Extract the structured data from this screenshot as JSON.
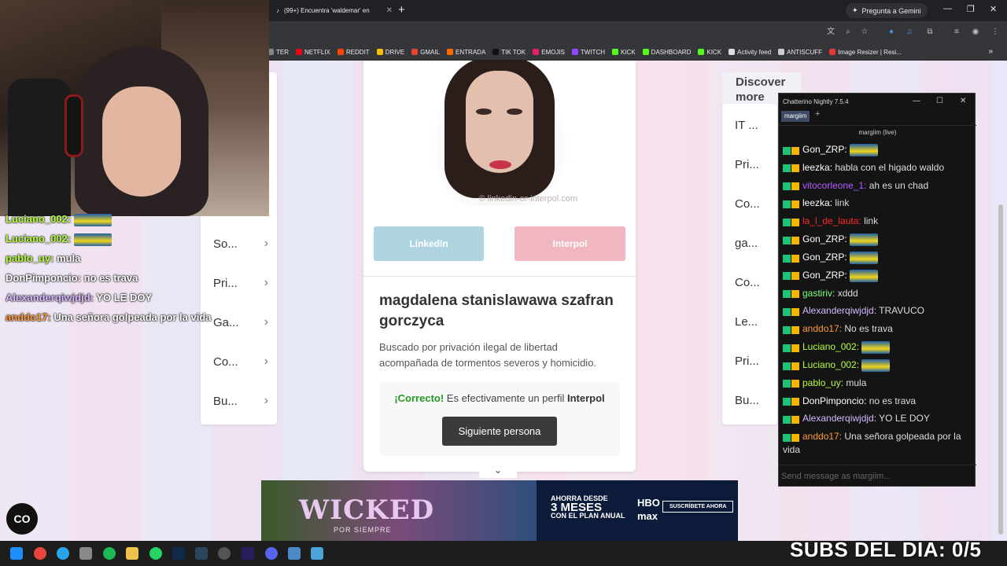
{
  "browser": {
    "tab_title": "(99+) Encuentra 'waldemar' en",
    "gemini_label": "Pregunta a Gemini",
    "bookmarks": [
      {
        "label": "TER",
        "color": "#888888"
      },
      {
        "label": "NETFLIX",
        "color": "#e50914"
      },
      {
        "label": "REDDIT",
        "color": "#ff4500"
      },
      {
        "label": "DRIVE",
        "color": "#fbbc04"
      },
      {
        "label": "GMAIL",
        "color": "#ea4335"
      },
      {
        "label": "ENTRADA",
        "color": "#ff6a00"
      },
      {
        "label": "TIK TOK",
        "color": "#111111"
      },
      {
        "label": "EMOJIS",
        "color": "#e91e63"
      },
      {
        "label": "TWITCH",
        "color": "#9146ff"
      },
      {
        "label": "KICK",
        "color": "#53fc18"
      },
      {
        "label": "DASHBOARD",
        "color": "#53fc18"
      },
      {
        "label": "KICK",
        "color": "#53fc18"
      },
      {
        "label": "Activity feed",
        "color": "#dddddd"
      },
      {
        "label": "ANTISCUFF",
        "color": "#cccccc"
      },
      {
        "label": "Image Resizer | Resi...",
        "color": "#e53935"
      }
    ]
  },
  "game": {
    "left_nav": [
      "So...",
      "Pri...",
      "Ga...",
      "Co...",
      "Bu..."
    ],
    "right_nav": [
      "IT ...",
      "Pri...",
      "Co...",
      "ga...",
      "Co...",
      "Le...",
      "Pri...",
      "Bu..."
    ],
    "discover_label": "Discover more",
    "photo_watermark": "© linkedin-or-interpol.com",
    "linkedin_label": "LinkedIn",
    "interpol_label": "Interpol",
    "person_name": "magdalena stanislawawa szafran gorczyca",
    "description": "Buscado por privación ilegal de libertad acompañada de tormentos severos y homicidio.",
    "result_ok": "¡Correcto!",
    "result_text": " Es efectivamente un perfil ",
    "result_type": "Interpol",
    "next_label": "Siguiente persona"
  },
  "ad": {
    "title": "WICKED",
    "subtitle": "POR SIEMPRE",
    "promo_line1": "AHORRA DESDE",
    "promo_line2": "3 MESES",
    "promo_line3": "CON EL PLAN ANUAL",
    "brand": "HBO max",
    "cta": "SUSCRÍBETE AHORA"
  },
  "chatterino": {
    "window_title": "Chatterino Nightly 7.5.4",
    "tab_label": "margiim",
    "channel_label": "margiim (live)",
    "input_placeholder": "Send message as margiim...",
    "messages": [
      {
        "user": "Gon_ZRP",
        "color": "#ffffff",
        "text": "",
        "emote": true
      },
      {
        "user": "leezka",
        "color": "#ffffff",
        "text": "habla con el higado waldo",
        "emote": false
      },
      {
        "user": "vitocorleone_1",
        "color": "#b55cff",
        "text": "ah es un chad",
        "emote": false
      },
      {
        "user": "leezka",
        "color": "#ffffff",
        "text": "link",
        "emote": false
      },
      {
        "user": "la_l_de_lauta",
        "color": "#ff2a2a",
        "text": "link",
        "emote": false
      },
      {
        "user": "Gon_ZRP",
        "color": "#ffffff",
        "text": "",
        "emote": true
      },
      {
        "user": "Gon_ZRP",
        "color": "#ffffff",
        "text": "",
        "emote": true
      },
      {
        "user": "Gon_ZRP",
        "color": "#ffffff",
        "text": "",
        "emote": true
      },
      {
        "user": "gastiriv",
        "color": "#7cff7c",
        "text": "xddd",
        "emote": false
      },
      {
        "user": "Alexanderqiwjdjd",
        "color": "#d7b8ff",
        "text": "TRAVUCO",
        "emote": false
      },
      {
        "user": "anddo17",
        "color": "#ff9a3c",
        "text": "No es trava",
        "emote": false
      },
      {
        "user": "Luciano_002",
        "color": "#b7ff3c",
        "text": "",
        "emote": true
      },
      {
        "user": "Luciano_002",
        "color": "#b7ff3c",
        "text": "",
        "emote": true
      },
      {
        "user": "pablo_uy",
        "color": "#b7ff3c",
        "text": "mula",
        "emote": false
      },
      {
        "user": "DonPimponcio",
        "color": "#ffffff",
        "text": "no es trava",
        "emote": false
      },
      {
        "user": "Alexanderqiwjdjd",
        "color": "#d7b8ff",
        "text": "YO LE DOY",
        "emote": false
      },
      {
        "user": "anddo17",
        "color": "#ff9a3c",
        "text": "Una señora golpeada por la vida",
        "emote": false
      }
    ]
  },
  "stream_overlay": {
    "lines": [
      {
        "user": "Luciano_002",
        "color": "#b7ff3c",
        "text": ""
      },
      {
        "user": "Luciano_002",
        "color": "#b7ff3c",
        "text": ""
      },
      {
        "user": "pablo_uy",
        "color": "#b7ff3c",
        "text": "mula"
      },
      {
        "user": "DonPimponcio",
        "color": "#ffffff",
        "text": "no es trava"
      },
      {
        "user": "Alexanderqiwjdjd",
        "color": "#d7b8ff",
        "text": "YO LE DOY"
      },
      {
        "user": "anddo17",
        "color": "#ff9a3c",
        "text": "Una señora golpeada por la vida"
      }
    ],
    "subs_text": "SUBS DEL DIA: 0/5",
    "cc_label": "CO"
  }
}
